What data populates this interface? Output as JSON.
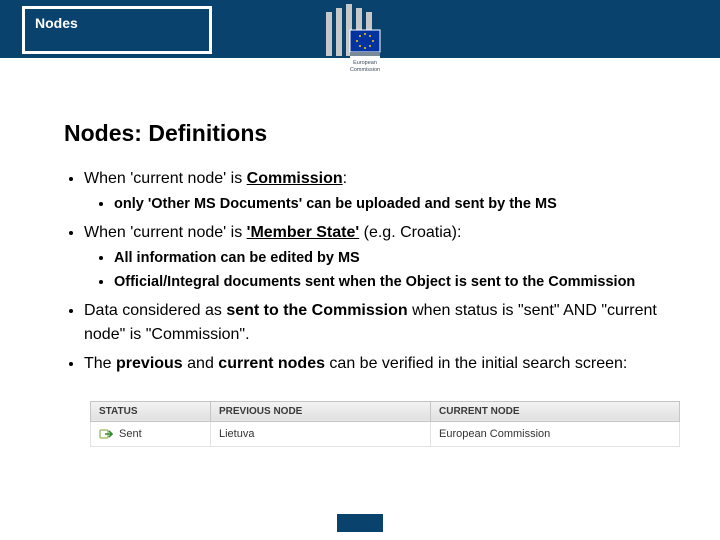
{
  "header": {
    "box_label": "Nodes",
    "logo_text": "European Commission"
  },
  "heading": "Nodes: Definitions",
  "bullets": {
    "b1_prefix": "When 'current node' is ",
    "b1_commission": "Commission",
    "b1_suffix": ":",
    "b1_sub1": "only 'Other MS Documents' can be uploaded and sent by the MS",
    "b2_prefix": "When 'current node' is ",
    "b2_ms": "'Member State'",
    "b2_suffix": " (e.g. Croatia):",
    "b2_sub1": "All information can be edited by MS",
    "b2_sub2": "Official/Integral documents sent when the Object is sent to the Commission",
    "b3_a": "Data considered as ",
    "b3_b": "sent to the Commission",
    "b3_c": " when status is \"sent\" AND \"current node\" is \"Commission\".",
    "b4_a": "The ",
    "b4_b": "previous",
    "b4_c": " and ",
    "b4_d": "current nodes",
    "b4_e": " can be verified in the initial search screen:"
  },
  "table": {
    "headers": {
      "status": "STATUS",
      "prev": "PREVIOUS NODE",
      "curr": "CURRENT NODE"
    },
    "row": {
      "status": "Sent",
      "prev": "Lietuva",
      "curr": "European Commission"
    }
  }
}
